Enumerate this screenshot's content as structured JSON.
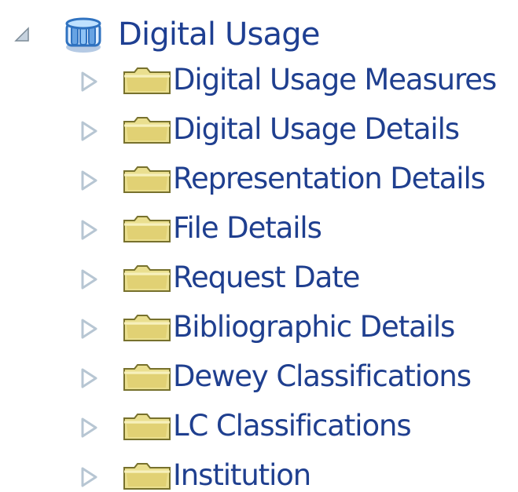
{
  "tree": {
    "root": {
      "label": "Digital Usage",
      "icon": "cube-icon",
      "expanded": true
    },
    "children": [
      {
        "label": "Digital Usage Measures",
        "icon": "folder-icon"
      },
      {
        "label": "Digital Usage Details",
        "icon": "folder-icon"
      },
      {
        "label": "Representation Details",
        "icon": "folder-icon"
      },
      {
        "label": "File Details",
        "icon": "folder-icon"
      },
      {
        "label": "Request Date",
        "icon": "folder-icon"
      },
      {
        "label": "Bibliographic Details",
        "icon": "folder-icon"
      },
      {
        "label": "Dewey Classifications",
        "icon": "folder-icon"
      },
      {
        "label": "LC Classifications",
        "icon": "folder-icon"
      },
      {
        "label": "Institution",
        "icon": "folder-icon"
      }
    ]
  },
  "colors": {
    "text": "#1f3f8f",
    "folder": "#e8dd8c",
    "folder_outline": "#8a8138",
    "arrow": "#c9d6e2",
    "cube": "#3f7fc6"
  }
}
